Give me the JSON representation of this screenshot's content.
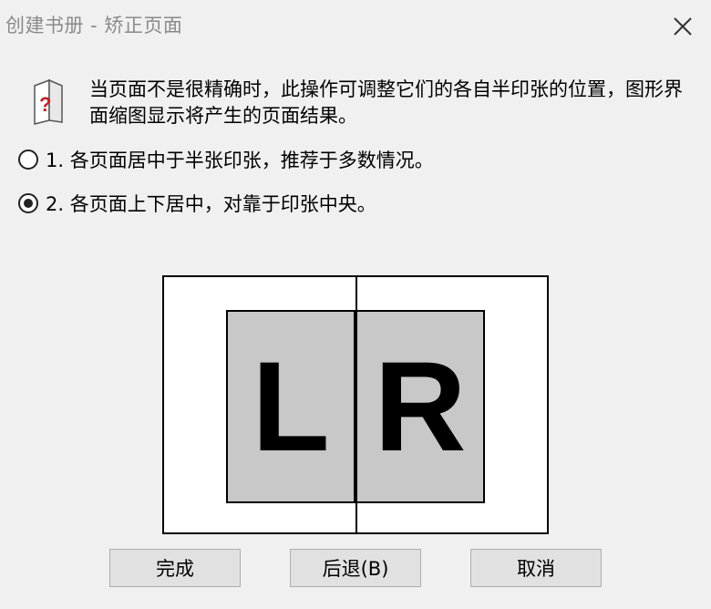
{
  "window": {
    "title": "创建书册 - 矫正页面",
    "close_icon": "close-icon"
  },
  "dialog": {
    "help_icon": "help-document-icon",
    "description": "当页面不是很精确时，此操作可调整它们的各自半印张的位置，图形界面缩图显示将产生的页面结果。"
  },
  "options": [
    {
      "label": "1. 各页面居中于半张印张，推荐于多数情况。",
      "selected": false
    },
    {
      "label": "2. 各页面上下居中，对靠于印张中央。",
      "selected": true
    }
  ],
  "preview": {
    "left_page": "L",
    "right_page": "R"
  },
  "buttons": {
    "finish": "完成",
    "back": "后退(B)",
    "cancel": "取消"
  }
}
